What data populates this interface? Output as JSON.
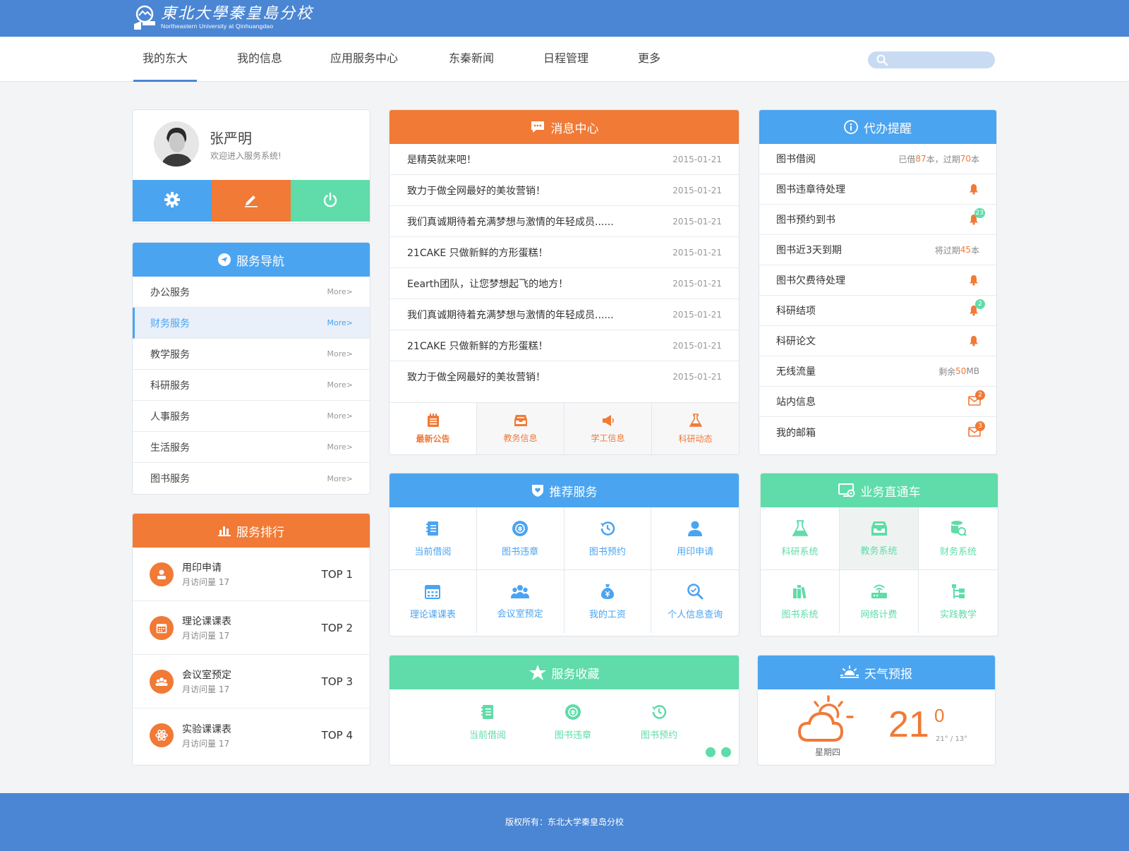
{
  "header": {
    "logo_cn": "東北大學秦皇島分校",
    "logo_en": "Northeastern University at Qinhuangdao",
    "brand_color": "#4a86d3"
  },
  "nav": {
    "items": [
      {
        "label": "我的东大",
        "active": true
      },
      {
        "label": "我的信息"
      },
      {
        "label": "应用服务中心"
      },
      {
        "label": "东秦新闻"
      },
      {
        "label": "日程管理"
      },
      {
        "label": "更多"
      }
    ],
    "search": {
      "icon": "search-icon",
      "placeholder": ""
    }
  },
  "profile": {
    "name": "张严明",
    "welcome": "欢迎进入服务系统!",
    "buttons": [
      {
        "icon": "gear-icon",
        "color": "#4ba4f0"
      },
      {
        "icon": "pencil-icon",
        "color": "#f07a36"
      },
      {
        "icon": "power-icon",
        "color": "#5fdca9"
      }
    ]
  },
  "service_nav": {
    "title": "服务导航",
    "more_label": "More>",
    "items": [
      "办公服务",
      "财务服务",
      "教学服务",
      "科研服务",
      "人事服务",
      "生活服务",
      "图书服务"
    ],
    "selected": "财务服务"
  },
  "ranking": {
    "title": "服务排行",
    "items": [
      {
        "name": "用印申请",
        "sub": "月访问量 17",
        "rank": "TOP 1",
        "icon": "user-icon"
      },
      {
        "name": "理论课课表",
        "sub": "月访问量 17",
        "rank": "TOP 2",
        "icon": "calendar-icon"
      },
      {
        "name": "会议室预定",
        "sub": "月访问量 17",
        "rank": "TOP 3",
        "icon": "group-icon"
      },
      {
        "name": "实验课课表",
        "sub": "月访问量 17",
        "rank": "TOP 4",
        "icon": "atom-icon"
      }
    ]
  },
  "messages": {
    "title": "消息中心",
    "items": [
      {
        "text": "是精英就来吧！",
        "date": "2015-01-21"
      },
      {
        "text": "致力于做全网最好的美妆营销！",
        "date": "2015-01-21"
      },
      {
        "text": "我们真诚期待着充满梦想与激情的年轻成员......",
        "date": "2015-01-21"
      },
      {
        "text": "21CAKE  只做新鲜的方形蛋糕！",
        "date": "2015-01-21"
      },
      {
        "text": "Eearth团队，让您梦想起飞的地方！",
        "date": "2015-01-21"
      },
      {
        "text": "我们真诚期待着充满梦想与激情的年轻成员......",
        "date": "2015-01-21"
      },
      {
        "text": "21CAKE  只做新鲜的方形蛋糕！",
        "date": "2015-01-21"
      },
      {
        "text": "致力于做全网最好的美妆营销！",
        "date": "2015-01-21"
      }
    ],
    "tabs": [
      {
        "label": "最新公告",
        "icon": "notice-icon"
      },
      {
        "label": "教务信息",
        "icon": "inbox-icon"
      },
      {
        "label": "学工信息",
        "icon": "megaphone-icon"
      },
      {
        "label": "科研动态",
        "icon": "flask-icon"
      }
    ]
  },
  "reminders": {
    "title": "代办提醒",
    "items": [
      {
        "label": "图书借阅",
        "pre": "已借",
        "n1": "87",
        "mid": "本，过期",
        "n2": "70",
        "post": "本"
      },
      {
        "label": "图书违章待处理",
        "icon": "bell-icon"
      },
      {
        "label": "图书预约到书",
        "icon": "bell-icon",
        "badge": "23",
        "badge_color": "green"
      },
      {
        "label": "图书近3天到期",
        "pre": "将过期",
        "n1": "45",
        "mid": "本"
      },
      {
        "label": "图书欠费待处理",
        "icon": "bell-icon"
      },
      {
        "label": "科研结项",
        "icon": "bell-icon",
        "badge": "2",
        "badge_color": "green"
      },
      {
        "label": "科研论文",
        "icon": "bell-icon"
      },
      {
        "label": "无线流量",
        "pre": "剩余",
        "n1": "50",
        "mid": "MB"
      },
      {
        "label": "站内信息",
        "icon": "mail-icon",
        "badge": "2",
        "badge_color": "orange"
      },
      {
        "label": "我的邮箱",
        "icon": "mail-icon",
        "badge": "3",
        "badge_color": "orange"
      }
    ]
  },
  "recommend": {
    "title": "推荐服务",
    "items": [
      {
        "label": "当前借阅",
        "icon": "book-icon"
      },
      {
        "label": "图书违章",
        "icon": "ticket-icon"
      },
      {
        "label": "图书预约",
        "icon": "clock-icon"
      },
      {
        "label": "用印申请",
        "icon": "user-icon"
      },
      {
        "label": "理论课课表",
        "icon": "calendar-icon"
      },
      {
        "label": "会议室预定",
        "icon": "group-icon"
      },
      {
        "label": "我的工资",
        "icon": "money-bag-icon"
      },
      {
        "label": "个人信息查询",
        "icon": "search-icon"
      }
    ]
  },
  "business": {
    "title": "业务直通车",
    "items": [
      {
        "label": "科研系统",
        "icon": "flask-icon"
      },
      {
        "label": "教务系统",
        "icon": "inbox-icon",
        "selected": true
      },
      {
        "label": "财务系统",
        "icon": "database-icon"
      },
      {
        "label": "图书系统",
        "icon": "books-icon"
      },
      {
        "label": "网络计费",
        "icon": "router-icon"
      },
      {
        "label": "实践教学",
        "icon": "tree-icon"
      }
    ]
  },
  "favorites": {
    "title": "服务收藏",
    "items": [
      {
        "label": "当前借阅",
        "icon": "book-icon"
      },
      {
        "label": "图书违章",
        "icon": "ticket-icon"
      },
      {
        "label": "图书预约",
        "icon": "clock-icon"
      }
    ]
  },
  "weather": {
    "title": "天气预报",
    "day": "星期四",
    "temp": "21",
    "deg": "0",
    "range": "21° / 13°",
    "icon": "partly-cloudy-icon"
  },
  "footer": {
    "text": "版权所有：东北大学秦皇岛分校"
  }
}
